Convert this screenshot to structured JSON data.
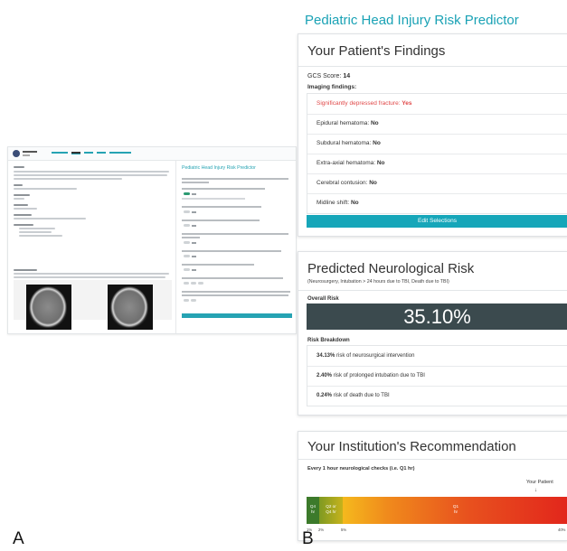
{
  "panel_labels": {
    "a": "A",
    "b": "B"
  },
  "panel_a": {
    "right_title": "Pediatric Head Injury Risk Predictor"
  },
  "panel_b": {
    "app_title": "Pediatric Head Injury Risk Predictor",
    "findings": {
      "title": "Your Patient's Findings",
      "gcs_label": "GCS Score:",
      "gcs_value": "14",
      "imaging_label": "Imaging findings:",
      "rows": [
        {
          "label": "Significantly depressed fracture:",
          "value": "Yes",
          "positive": true
        },
        {
          "label": "Epidural hematoma:",
          "value": "No"
        },
        {
          "label": "Subdural hematoma:",
          "value": "No"
        },
        {
          "label": "Extra-axial hematoma:",
          "value": "No"
        },
        {
          "label": "Cerebral contusion:",
          "value": "No"
        },
        {
          "label": "Midline shift:",
          "value": "No"
        }
      ],
      "edit_button": "Edit Selections"
    },
    "risk": {
      "title": "Predicted Neurological Risk",
      "subtitle": "(Neurosurgery, Intubation > 24 hours due to TBI, Death due to TBI)",
      "overall_label": "Overall Risk",
      "overall_value": "35.10%",
      "breakdown_label": "Risk Breakdown",
      "rows": [
        {
          "value": "34.13%",
          "label": "risk of neurosurgical intervention"
        },
        {
          "value": "2.40%",
          "label": "risk of prolonged intubation due to TBI"
        },
        {
          "value": "0.24%",
          "label": "risk of death due to TBI"
        }
      ]
    },
    "recommendation": {
      "title": "Your Institution's Recommendation",
      "subtitle": "Every 1 hour neurological checks (i.e. Q1 hr)",
      "your_patient": "Your Patient",
      "arrow": "↓",
      "segments": [
        {
          "label1": "Q4",
          "label2": "hr",
          "color": "#3f7d2a"
        },
        {
          "label1": "Q2 or",
          "label2": "Q4 hr",
          "color": "#9aa61f"
        },
        {
          "label1": "Q1",
          "label2": "hr",
          "color": "#e24a1f"
        }
      ],
      "ticks": [
        "1%",
        "2%",
        "5%",
        "40%"
      ]
    }
  }
}
